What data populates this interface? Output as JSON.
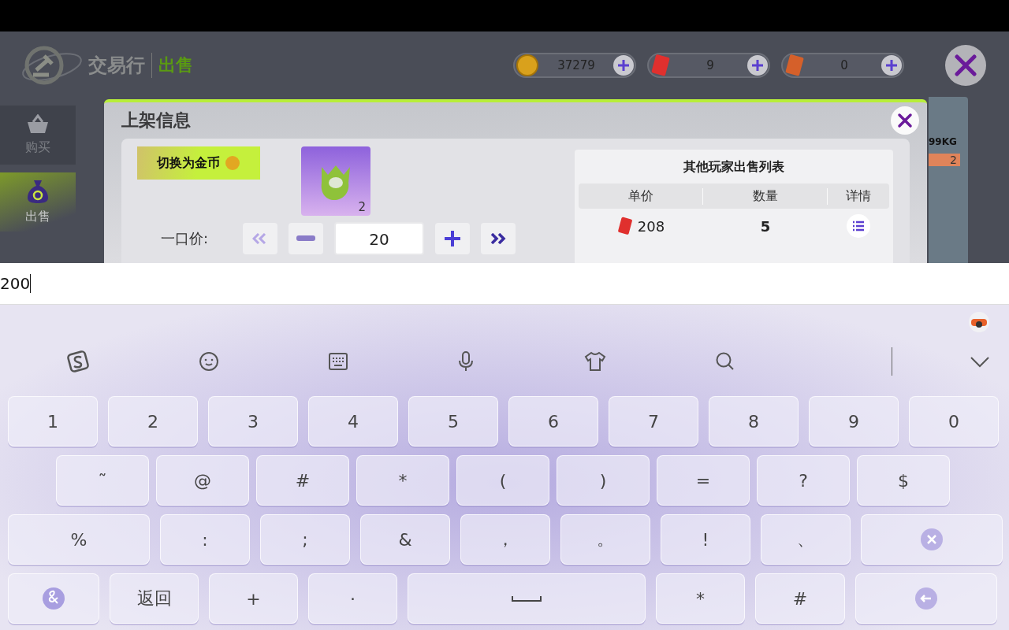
{
  "header": {
    "title": "交易行",
    "subtitle": "出售"
  },
  "currencies": [
    {
      "kind": "coin",
      "amount": "37279"
    },
    {
      "kind": "red_ticket",
      "amount": "9"
    },
    {
      "kind": "orange_ticket",
      "amount": "0"
    }
  ],
  "sidebar": [
    {
      "kind": "basket",
      "label": "购买",
      "selected": false
    },
    {
      "kind": "bag",
      "label": "出售",
      "selected": true
    }
  ],
  "dialog": {
    "title": "上架信息",
    "toggle_button": "切换为金币",
    "item": {
      "count": "2"
    },
    "price_label": "一口价:",
    "price_value": "20",
    "listing": {
      "title": "其他玩家出售列表",
      "columns": [
        "单价",
        "数量",
        "详情"
      ],
      "rows": [
        {
          "price": "208",
          "quantity": "5"
        }
      ]
    }
  },
  "side_peek": {
    "weight": "99KG",
    "count": "2"
  },
  "input": {
    "value": "200"
  },
  "keyboard": {
    "number_row": [
      {
        "kind": "char",
        "label": "1"
      },
      {
        "kind": "char",
        "label": "2"
      },
      {
        "kind": "char",
        "label": "3"
      },
      {
        "kind": "char",
        "label": "4"
      },
      {
        "kind": "char",
        "label": "5"
      },
      {
        "kind": "char",
        "label": "6"
      },
      {
        "kind": "char",
        "label": "7"
      },
      {
        "kind": "char",
        "label": "8"
      },
      {
        "kind": "char",
        "label": "9"
      },
      {
        "kind": "char",
        "label": "0"
      }
    ],
    "symbol_row": [
      {
        "kind": "char",
        "label": "˜"
      },
      {
        "kind": "char",
        "label": "@"
      },
      {
        "kind": "char",
        "label": "#"
      },
      {
        "kind": "char",
        "label": "*"
      },
      {
        "kind": "char",
        "label": "("
      },
      {
        "kind": "char",
        "label": ")"
      },
      {
        "kind": "char",
        "label": "="
      },
      {
        "kind": "char",
        "label": "?"
      },
      {
        "kind": "char",
        "label": "$"
      }
    ],
    "punctuation_row": [
      {
        "kind": "char",
        "label": "%"
      },
      {
        "kind": "char",
        "label": ":"
      },
      {
        "kind": "char",
        "label": ";"
      },
      {
        "kind": "char",
        "label": "&"
      },
      {
        "kind": "char",
        "label": "，"
      },
      {
        "kind": "char",
        "label": "。"
      },
      {
        "kind": "char",
        "label": "!"
      },
      {
        "kind": "char",
        "label": "、"
      },
      {
        "kind": "backspace"
      }
    ],
    "bottom_row": [
      {
        "kind": "symbol"
      },
      {
        "kind": "char",
        "label": "返回"
      },
      {
        "kind": "char",
        "label": "+"
      },
      {
        "kind": "char",
        "label": "·"
      },
      {
        "kind": "space"
      },
      {
        "kind": "char",
        "label": "*"
      },
      {
        "kind": "char",
        "label": "#"
      },
      {
        "kind": "enter"
      }
    ]
  }
}
